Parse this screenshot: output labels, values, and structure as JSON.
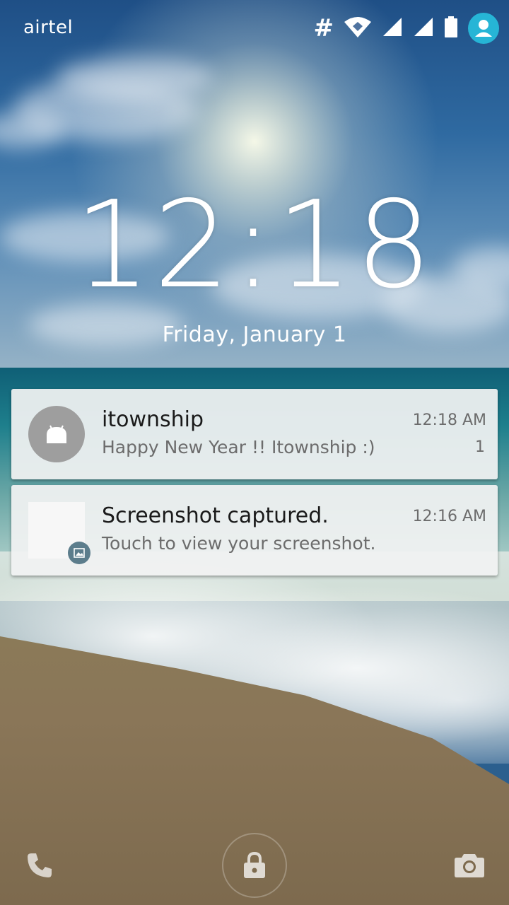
{
  "status_bar": {
    "carrier": "airtel",
    "data_symbol": "#",
    "icons": [
      "wifi-icon",
      "signal-icon",
      "signal-icon",
      "battery-icon",
      "user-avatar-icon"
    ],
    "accent": "#26b5d6"
  },
  "lockscreen": {
    "time": "12:18",
    "date": "Friday, January 1"
  },
  "notifications": [
    {
      "app_icon": "android-icon",
      "title": "itownship",
      "text": "Happy New Year !! Itownship :)",
      "time": "12:18 AM",
      "count": "1"
    },
    {
      "app_icon": "image-icon",
      "title": "Screenshot captured.",
      "text": "Touch to view your screenshot.",
      "time": "12:16 AM"
    }
  ],
  "bottom_bar": {
    "left": "phone-icon",
    "center": "lock-icon",
    "right": "camera-icon"
  }
}
